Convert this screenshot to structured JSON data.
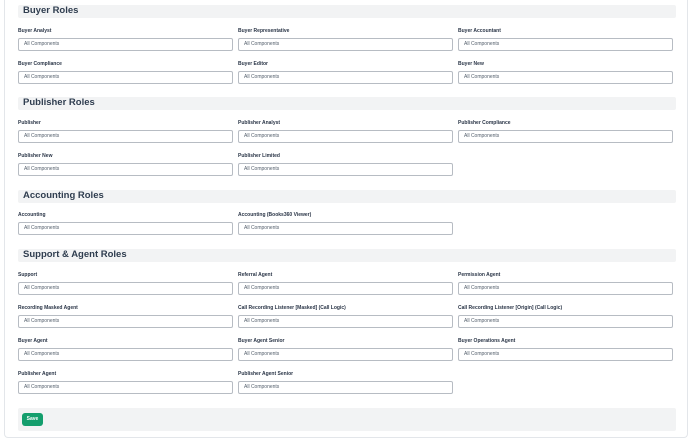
{
  "sections": [
    {
      "title": "Buyer Roles",
      "fields": [
        {
          "label": "Buyer Analyst",
          "value": "All Components"
        },
        {
          "label": "Buyer Representative",
          "value": "All Components"
        },
        {
          "label": "Buyer Accountant",
          "value": "All Components"
        },
        {
          "label": "Buyer Compliance",
          "value": "All Components"
        },
        {
          "label": "Buyer Editor",
          "value": "All Components"
        },
        {
          "label": "Buyer New",
          "value": "All Components"
        }
      ]
    },
    {
      "title": "Publisher Roles",
      "fields": [
        {
          "label": "Publisher",
          "value": "All Components"
        },
        {
          "label": "Publisher Analyst",
          "value": "All Components"
        },
        {
          "label": "Publisher Compliance",
          "value": "All Components"
        },
        {
          "label": "Publisher New",
          "value": "All Components"
        },
        {
          "label": "Publisher Limited",
          "value": "All Components"
        }
      ]
    },
    {
      "title": "Accounting Roles",
      "fields": [
        {
          "label": "Accounting",
          "value": "All Components"
        },
        {
          "label": "Accounting (Books360 Viewer)",
          "value": "All Components"
        }
      ]
    },
    {
      "title": "Support & Agent Roles",
      "fields": [
        {
          "label": "Support",
          "value": "All Components"
        },
        {
          "label": "Referral Agent",
          "value": "All Components"
        },
        {
          "label": "Permission Agent",
          "value": "All Components"
        },
        {
          "label": "Recording Masked Agent",
          "value": "All Components"
        },
        {
          "label": "Call Recording Listener [Masked] (Call Logic)",
          "value": "All Components"
        },
        {
          "label": "Call Recording Listener [Origin] (Call Logic)",
          "value": "All Components"
        },
        {
          "label": "Buyer Agent",
          "value": "All Components"
        },
        {
          "label": "Buyer Agent Senior",
          "value": "All Components"
        },
        {
          "label": "Buyer Operations Agent",
          "value": "All Components"
        },
        {
          "label": "Publisher Agent",
          "value": "All Components"
        },
        {
          "label": "Publisher Agent Senior",
          "value": "All Components"
        }
      ]
    }
  ],
  "footer": {
    "save_label": "Save"
  },
  "colors": {
    "accent": "#149e6d",
    "section_bg": "#f2f3f4",
    "border": "#b7bcc3"
  }
}
